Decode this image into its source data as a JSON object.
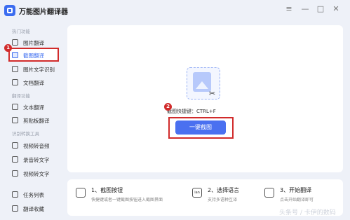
{
  "app": {
    "title": "万能图片翻译器"
  },
  "window_controls": {
    "minimize": "—",
    "restore": "□",
    "close": "✕",
    "menu": "≡"
  },
  "sidebar": {
    "sections": [
      {
        "label": "热门功能"
      },
      {
        "label": "翻译功能"
      },
      {
        "label": "识别转换工具"
      }
    ],
    "items": [
      {
        "label": "图片翻译",
        "icon": "image-icon"
      },
      {
        "label": "截图翻译",
        "icon": "screenshot-icon",
        "active": true
      },
      {
        "label": "图片文字识别",
        "icon": "text-recognize-icon"
      },
      {
        "label": "文档翻译",
        "icon": "document-icon"
      },
      {
        "label": "文本翻译",
        "icon": "text-icon"
      },
      {
        "label": "剪贴板翻译",
        "icon": "clipboard-icon"
      },
      {
        "label": "视频转音频",
        "icon": "video-icon"
      },
      {
        "label": "录音转文字",
        "icon": "mic-icon"
      },
      {
        "label": "视频转文字",
        "icon": "video-text-icon"
      },
      {
        "label": "任务列表",
        "icon": "list-icon"
      },
      {
        "label": "翻译收藏",
        "icon": "star-icon"
      }
    ]
  },
  "badges": {
    "one": "1",
    "two": "2"
  },
  "main": {
    "shortcut_text": "截图快捷键：CTRL+F",
    "cta_label": "一键截图",
    "scissors_glyph": "✂"
  },
  "steps": [
    {
      "title": "1、截图按钮",
      "desc": "快捷键或者一键截图按钮进入截图界面",
      "icon": "screenshot-icon"
    },
    {
      "title": "2、选择语言",
      "desc": "支持多语种互译",
      "icon": "language-icon",
      "icon_text": "ian"
    },
    {
      "title": "3、开始翻译",
      "desc": "点击开始翻译即可",
      "icon": "translate-icon"
    }
  ],
  "watermark": "头条号 / 卡伊的数码",
  "colors": {
    "accent": "#4a70f0",
    "highlight": "#d12b2b",
    "background": "#eef1f8"
  }
}
